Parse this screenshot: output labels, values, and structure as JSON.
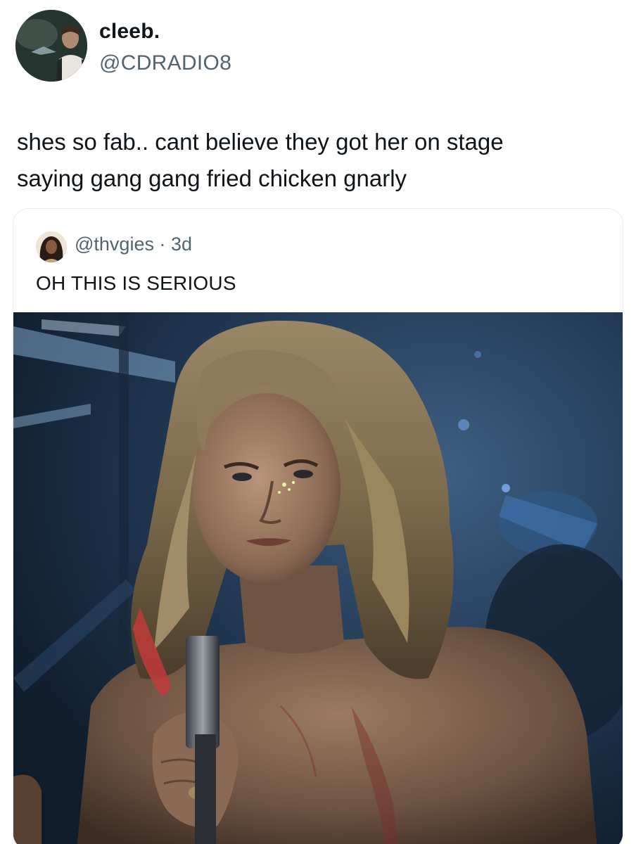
{
  "tweet": {
    "author_name": "cleeb.",
    "author_handle": "@CDRADIO8",
    "text_line_1": "shes so fab.. cant believe they got her on stage",
    "text_line_2": "saying gang gang fried chicken gnarly"
  },
  "quoted_tweet": {
    "handle": "@thvgies",
    "separator": "·",
    "age": "3d",
    "text": "OH THIS IS SERIOUS",
    "media_description_icon": "photo"
  },
  "colors": {
    "text_primary": "#0f1419",
    "text_secondary": "#536471",
    "card_border": "#e6ecf0"
  }
}
